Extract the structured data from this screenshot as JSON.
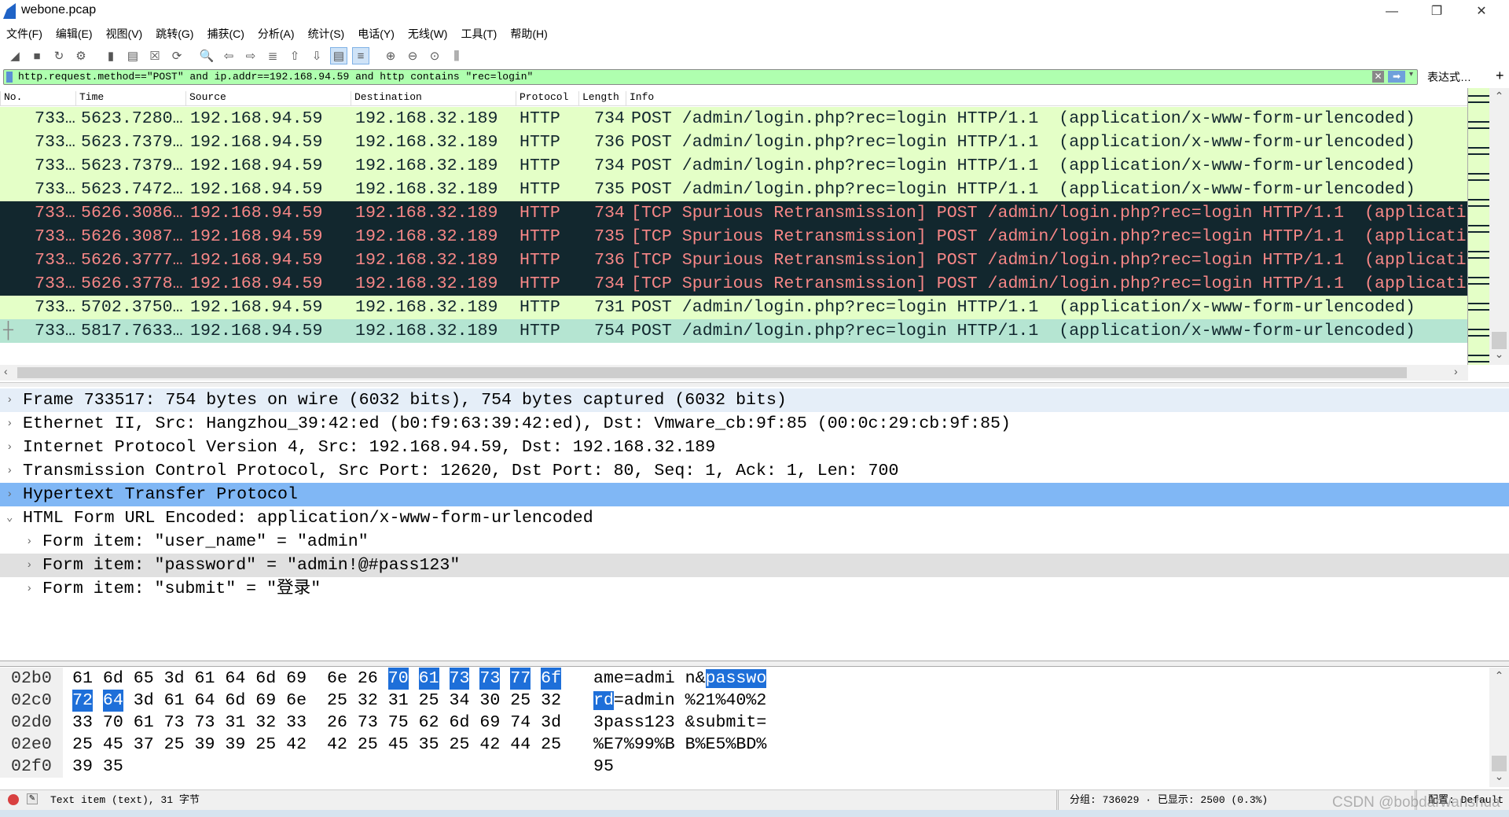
{
  "window": {
    "title": "webone.pcap",
    "minimize": "—",
    "restore": "❐",
    "close": "✕"
  },
  "menu": [
    "文件(F)",
    "编辑(E)",
    "视图(V)",
    "跳转(G)",
    "捕获(C)",
    "分析(A)",
    "统计(S)",
    "电话(Y)",
    "无线(W)",
    "工具(T)",
    "帮助(H)"
  ],
  "toolbar": [
    {
      "icon": "start-capture-icon",
      "glyph": "◢"
    },
    {
      "icon": "stop-capture-icon",
      "glyph": "■"
    },
    {
      "icon": "restart-capture-icon",
      "glyph": "↻"
    },
    {
      "icon": "capture-options-icon",
      "glyph": "⚙"
    },
    {
      "icon": "open-file-icon",
      "glyph": "▮"
    },
    {
      "icon": "save-file-icon",
      "glyph": "▤"
    },
    {
      "icon": "close-file-icon",
      "glyph": "☒"
    },
    {
      "icon": "reload-icon",
      "glyph": "⟳"
    },
    {
      "icon": "find-packet-icon",
      "glyph": "🔍"
    },
    {
      "icon": "go-back-icon",
      "glyph": "⇦"
    },
    {
      "icon": "go-forward-icon",
      "glyph": "⇨"
    },
    {
      "icon": "go-to-packet-icon",
      "glyph": "≣"
    },
    {
      "icon": "first-packet-icon",
      "glyph": "⇧"
    },
    {
      "icon": "last-packet-icon",
      "glyph": "⇩"
    },
    {
      "icon": "autoscroll-icon",
      "glyph": "▤",
      "active": true
    },
    {
      "icon": "colorize-icon",
      "glyph": "≡",
      "active": true
    },
    {
      "icon": "zoom-in-icon",
      "glyph": "⊕"
    },
    {
      "icon": "zoom-out-icon",
      "glyph": "⊖"
    },
    {
      "icon": "zoom-reset-icon",
      "glyph": "⊙"
    },
    {
      "icon": "resize-columns-icon",
      "glyph": "⫼"
    }
  ],
  "filter": {
    "value": "http.request.method==\"POST\" and ip.addr==192.168.94.59 and http contains \"rec=login\"",
    "clear": "✕",
    "apply": "➡",
    "dropdown": "▾",
    "expression": "表达式…",
    "add": "+"
  },
  "columns": [
    "No.",
    "Time",
    "Source",
    "Destination",
    "Protocol",
    "Length",
    "Info"
  ],
  "packets": [
    {
      "no": "733…",
      "time": "5623.7280…",
      "src": "192.168.94.59",
      "dst": "192.168.32.189",
      "proto": "HTTP",
      "len": "734",
      "info": "POST /admin/login.php?rec=login HTTP/1.1  (application/x-www-form-urlencoded)",
      "style": "g"
    },
    {
      "no": "733…",
      "time": "5623.7379…",
      "src": "192.168.94.59",
      "dst": "192.168.32.189",
      "proto": "HTTP",
      "len": "736",
      "info": "POST /admin/login.php?rec=login HTTP/1.1  (application/x-www-form-urlencoded)",
      "style": "g"
    },
    {
      "no": "733…",
      "time": "5623.7379…",
      "src": "192.168.94.59",
      "dst": "192.168.32.189",
      "proto": "HTTP",
      "len": "734",
      "info": "POST /admin/login.php?rec=login HTTP/1.1  (application/x-www-form-urlencoded)",
      "style": "g"
    },
    {
      "no": "733…",
      "time": "5623.7472…",
      "src": "192.168.94.59",
      "dst": "192.168.32.189",
      "proto": "HTTP",
      "len": "735",
      "info": "POST /admin/login.php?rec=login HTTP/1.1  (application/x-www-form-urlencoded)",
      "style": "g"
    },
    {
      "no": "733…",
      "time": "5626.3086…",
      "src": "192.168.94.59",
      "dst": "192.168.32.189",
      "proto": "HTTP",
      "len": "734",
      "info": "[TCP Spurious Retransmission] POST /admin/login.php?rec=login HTTP/1.1  (applicati",
      "style": "d"
    },
    {
      "no": "733…",
      "time": "5626.3087…",
      "src": "192.168.94.59",
      "dst": "192.168.32.189",
      "proto": "HTTP",
      "len": "735",
      "info": "[TCP Spurious Retransmission] POST /admin/login.php?rec=login HTTP/1.1  (applicati",
      "style": "d"
    },
    {
      "no": "733…",
      "time": "5626.3777…",
      "src": "192.168.94.59",
      "dst": "192.168.32.189",
      "proto": "HTTP",
      "len": "736",
      "info": "[TCP Spurious Retransmission] POST /admin/login.php?rec=login HTTP/1.1  (applicati",
      "style": "d"
    },
    {
      "no": "733…",
      "time": "5626.3778…",
      "src": "192.168.94.59",
      "dst": "192.168.32.189",
      "proto": "HTTP",
      "len": "734",
      "info": "[TCP Spurious Retransmission] POST /admin/login.php?rec=login HTTP/1.1  (applicati",
      "style": "d"
    },
    {
      "no": "733…",
      "time": "5702.3750…",
      "src": "192.168.94.59",
      "dst": "192.168.32.189",
      "proto": "HTTP",
      "len": "731",
      "info": "POST /admin/login.php?rec=login HTTP/1.1  (application/x-www-form-urlencoded)",
      "style": "g"
    },
    {
      "no": "733…",
      "time": "5817.7633…",
      "src": "192.168.94.59",
      "dst": "192.168.32.189",
      "proto": "HTTP",
      "len": "754",
      "info": "POST /admin/login.php?rec=login HTTP/1.1  (application/x-www-form-urlencoded)",
      "style": "s"
    }
  ],
  "details": [
    {
      "text": "Frame 733517: 754 bytes on wire (6032 bits), 754 bytes captured (6032 bits)",
      "level": 0,
      "expanded": false,
      "style": "f"
    },
    {
      "text": "Ethernet II, Src: Hangzhou_39:42:ed (b0:f9:63:39:42:ed), Dst: Vmware_cb:9f:85 (00:0c:29:cb:9f:85)",
      "level": 0,
      "expanded": false,
      "style": ""
    },
    {
      "text": "Internet Protocol Version 4, Src: 192.168.94.59, Dst: 192.168.32.189",
      "level": 0,
      "expanded": false,
      "style": ""
    },
    {
      "text": "Transmission Control Protocol, Src Port: 12620, Dst Port: 80, Seq: 1, Ack: 1, Len: 700",
      "level": 0,
      "expanded": false,
      "style": ""
    },
    {
      "text": "Hypertext Transfer Protocol",
      "level": 0,
      "expanded": false,
      "style": "sel"
    },
    {
      "text": "HTML Form URL Encoded: application/x-www-form-urlencoded",
      "level": 0,
      "expanded": true,
      "style": ""
    },
    {
      "text": "Form item: \"user_name\" = \"admin\"",
      "level": 1,
      "expanded": false,
      "style": ""
    },
    {
      "text": "Form item: \"password\" = \"admin!@#pass123\"",
      "level": 1,
      "expanded": false,
      "style": "hl"
    },
    {
      "text": "Form item: \"submit\" = \"登录\"",
      "level": 1,
      "expanded": false,
      "style": ""
    }
  ],
  "hex": [
    {
      "offset": "02b0",
      "bytes": [
        "61",
        "6d",
        "65",
        "3d",
        "61",
        "64",
        "6d",
        "69",
        "6e",
        "26",
        "70",
        "61",
        "73",
        "73",
        "77",
        "6f"
      ],
      "hl": [
        10,
        11,
        12,
        13,
        14,
        15
      ],
      "ascii": [
        "ame=admi n&",
        "passwo",
        ""
      ]
    },
    {
      "offset": "02c0",
      "bytes": [
        "72",
        "64",
        "3d",
        "61",
        "64",
        "6d",
        "69",
        "6e",
        "25",
        "32",
        "31",
        "25",
        "34",
        "30",
        "25",
        "32"
      ],
      "hl": [
        0,
        1
      ],
      "ascii": [
        "",
        "rd",
        "=admin %21%40%2"
      ]
    },
    {
      "offset": "02d0",
      "bytes": [
        "33",
        "70",
        "61",
        "73",
        "73",
        "31",
        "32",
        "33",
        "26",
        "73",
        "75",
        "62",
        "6d",
        "69",
        "74",
        "3d"
      ],
      "hl": [],
      "ascii": [
        "3pass123 &submit=",
        "",
        ""
      ]
    },
    {
      "offset": "02e0",
      "bytes": [
        "25",
        "45",
        "37",
        "25",
        "39",
        "39",
        "25",
        "42",
        "42",
        "25",
        "45",
        "35",
        "25",
        "42",
        "44",
        "25"
      ],
      "hl": [],
      "ascii": [
        "%E7%99%B B%E5%BD%",
        "",
        ""
      ]
    },
    {
      "offset": "02f0",
      "bytes": [
        "39",
        "35"
      ],
      "hl": [],
      "ascii": [
        "95",
        "",
        ""
      ]
    }
  ],
  "status": {
    "item": "Text item (text), 31 字节",
    "packets": "分组: 736029 · 已显示: 2500 (0.3%)",
    "profile": "配置: Default"
  },
  "watermark": "CSDN @bobdarwanshua",
  "colors": {
    "normal_row": "#e4ffc7",
    "bad_row_bg": "#12272e",
    "bad_row_fg": "#f78787",
    "selected_row": "#b5e5d2",
    "selected_detail": "#80b7f5",
    "filter_valid": "#afffaf"
  }
}
